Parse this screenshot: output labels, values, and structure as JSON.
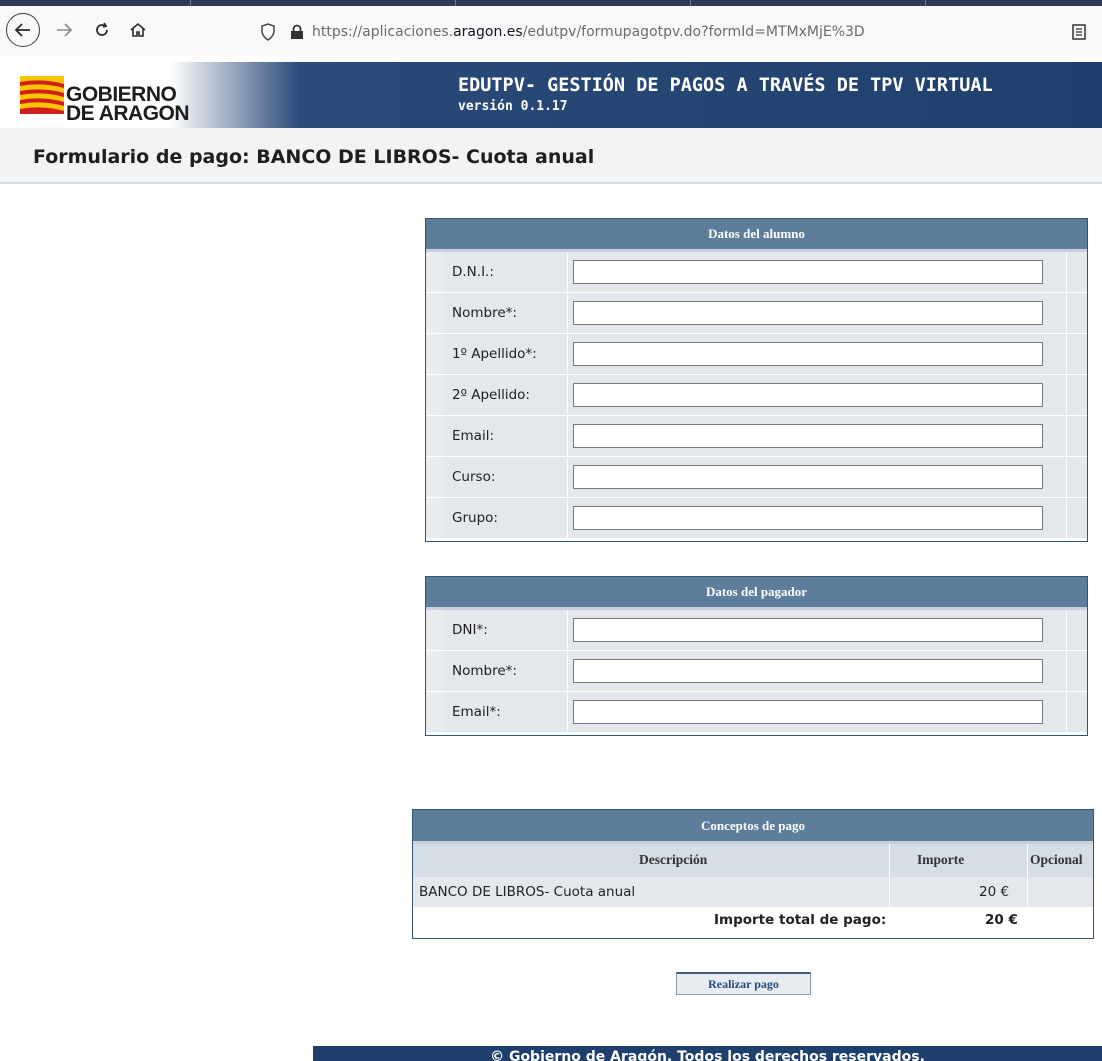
{
  "browser": {
    "url_prefix": "https://aplicaciones.",
    "url_domain": "aragon.es",
    "url_path": "/edutpv/formupagotpv.do?formId=MTMxMjE%3D"
  },
  "header": {
    "logo_line1": "GOBIERNO",
    "logo_line2": "DE ARAGON",
    "title": "EDUTPV- GESTIÓN DE PAGOS A TRAVÉS DE TPV VIRTUAL",
    "version": "versión 0.1.17"
  },
  "page_title": "Formulario de pago: BANCO DE LIBROS- Cuota anual",
  "alumno": {
    "heading": "Datos del alumno",
    "fields": [
      {
        "label": "D.N.I.:",
        "value": ""
      },
      {
        "label": "Nombre*:",
        "value": ""
      },
      {
        "label": "1º Apellido*:",
        "value": ""
      },
      {
        "label": "2º Apellido:",
        "value": ""
      },
      {
        "label": "Email:",
        "value": ""
      },
      {
        "label": "Curso:",
        "value": ""
      },
      {
        "label": "Grupo:",
        "value": ""
      }
    ]
  },
  "pagador": {
    "heading": "Datos del pagador",
    "fields": [
      {
        "label": "DNI*:",
        "value": ""
      },
      {
        "label": "Nombre*:",
        "value": ""
      },
      {
        "label": "Email*:",
        "value": ""
      }
    ]
  },
  "conceptos": {
    "heading": "Conceptos de pago",
    "col_descripcion": "Descripción",
    "col_importe": "Importe",
    "col_opcional": "Opcional",
    "item_descripcion": "BANCO DE LIBROS- Cuota anual",
    "item_importe": "20 €",
    "total_label": "Importe total de pago:",
    "total_value": "20 €"
  },
  "pay_button": "Realizar pago",
  "footer": "© Gobierno de Aragón. Todos los derechos reservados."
}
